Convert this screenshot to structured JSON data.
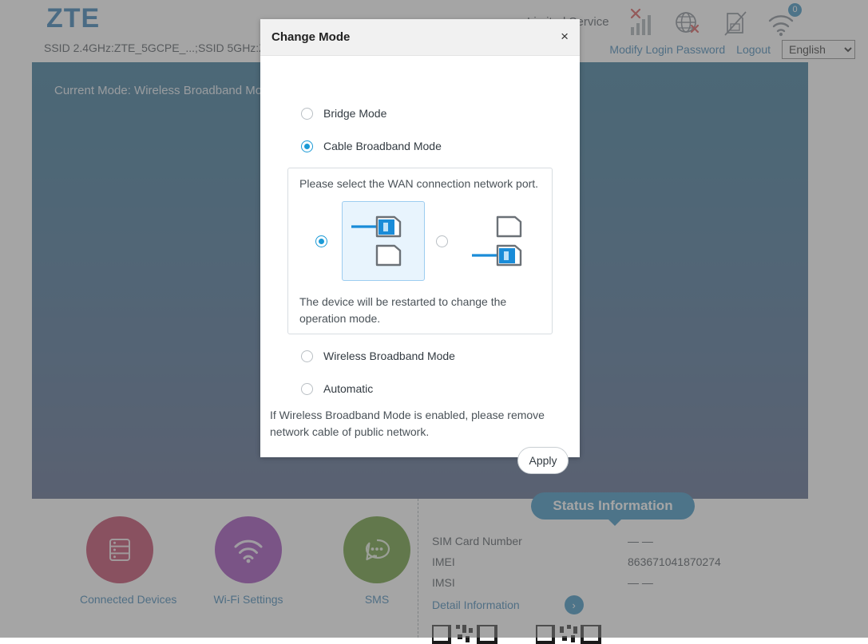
{
  "header": {
    "logo": "ZTE",
    "ssid_line": "SSID 2.4GHz:ZTE_5GCPE_...;SSID 5GHz:ZTE_5GCPE_...",
    "service_status": "Limited Service",
    "icons": [
      {
        "name": "signal-bars-error-icon",
        "label": "signal-bars-error"
      },
      {
        "name": "globe-error-icon",
        "label": "globe-error"
      },
      {
        "name": "sim-card-disabled-icon",
        "label": "sim-card-disabled"
      },
      {
        "name": "wifi-icon",
        "label": "wifi",
        "badge": "0"
      }
    ],
    "links": [
      {
        "name": "modify-login-password-link",
        "label": "Modify Login Password"
      },
      {
        "name": "logout-link",
        "label": "Logout"
      }
    ],
    "language": {
      "selected": "English",
      "options": [
        "English"
      ]
    }
  },
  "hero": {
    "current_mode": "Current Mode: Wireless Broadband Mode"
  },
  "modal": {
    "title": "Change Mode",
    "close_label": "×",
    "modes": [
      {
        "label": "Bridge Mode",
        "selected": false
      },
      {
        "label": "Cable Broadband Mode",
        "selected": true
      },
      {
        "label": "Wireless Broadband Mode",
        "selected": false
      },
      {
        "label": "Automatic",
        "selected": false
      }
    ],
    "wan": {
      "title": "Please select the WAN connection network port.",
      "note": "The device will be restarted to change the operation mode.",
      "options": [
        {
          "name": "wan-port-top",
          "selected": true
        },
        {
          "name": "wan-port-bottom",
          "selected": false
        }
      ]
    },
    "note": "If Wireless Broadband Mode is enabled, please remove network cable of public network.",
    "apply_label": "Apply"
  },
  "footer": {
    "shortcuts": [
      {
        "label": "Connected Devices",
        "icon": "server-list-icon",
        "color": "#b5234a"
      },
      {
        "label": "Wi-Fi Settings",
        "icon": "wifi-icon",
        "color": "#8e2bad"
      },
      {
        "label": "SMS",
        "icon": "chat-bubble-icon",
        "color": "#4f8a16"
      }
    ],
    "status": {
      "pill_label": "Status Information",
      "rows": [
        {
          "key": "SIM Card Number",
          "value": "— —"
        },
        {
          "key": "IMEI",
          "value": "863671041870274"
        },
        {
          "key": "IMSI",
          "value": "— —"
        }
      ],
      "detail_link": "Detail Information",
      "chevron": "›"
    }
  },
  "colors": {
    "brand_blue": "#1a7fb5",
    "link_blue": "#1f6fa8",
    "accent_cyan": "#1b9ad6",
    "hero_top": "#145f86",
    "hero_bottom": "#3a4d78"
  }
}
